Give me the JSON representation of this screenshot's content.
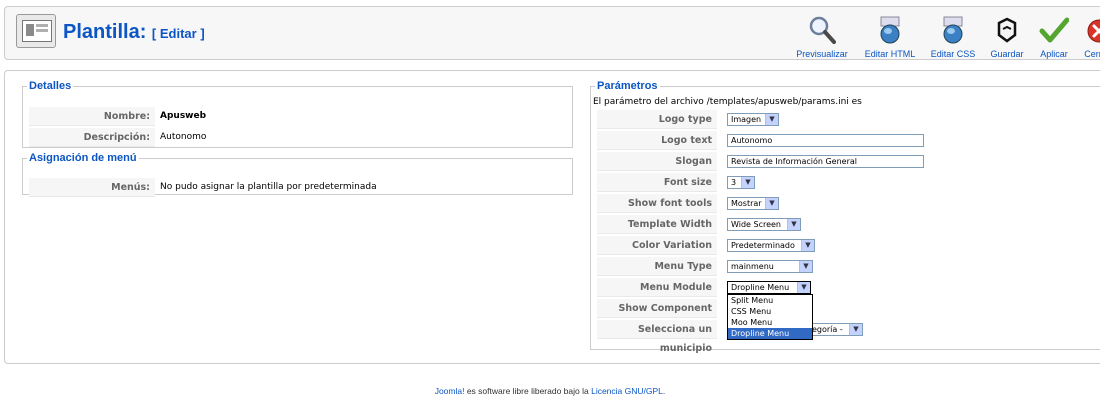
{
  "header": {
    "title": "Plantilla:",
    "subtitle": "[ Editar ]",
    "toolbar": [
      {
        "label": "Previsualizar",
        "icon": "magnifier-icon"
      },
      {
        "label": "Editar HTML",
        "icon": "edit-html-icon"
      },
      {
        "label": "Editar CSS",
        "icon": "edit-css-icon"
      },
      {
        "label": "Guardar",
        "icon": "save-icon"
      },
      {
        "label": "Aplicar",
        "icon": "apply-check-icon"
      },
      {
        "label": "Cerrar",
        "icon": "close-icon"
      }
    ]
  },
  "details": {
    "legend": "Detalles",
    "rows": [
      {
        "label": "Nombre:",
        "value": "Apusweb"
      },
      {
        "label": "Descripción:",
        "value": "Autonomo"
      }
    ]
  },
  "menu_assignment": {
    "legend": "Asignación de menú",
    "label": "Menús:",
    "value": "No pudo asignar la plantilla por predeterminada"
  },
  "params": {
    "legend": "Parámetros",
    "intro": "El parámetro del archivo /templates/apusweb/params.ini es",
    "rows": [
      {
        "label": "Logo type",
        "value": "Imagen"
      },
      {
        "label": "Logo text",
        "value": "Autonomo"
      },
      {
        "label": "Slogan",
        "value": "Revista de Información General"
      },
      {
        "label": "Font size",
        "value": "3"
      },
      {
        "label": "Show font tools",
        "value": "Mostrar"
      },
      {
        "label": "Template Width",
        "value": "Wide Screen"
      },
      {
        "label": "Color Variation",
        "value": "Predeterminado"
      },
      {
        "label": "Menu Type",
        "value": "mainmenu"
      },
      {
        "label": "Menu Module",
        "value": "Dropline Menu"
      },
      {
        "label": "Show Component",
        "value": ""
      },
      {
        "label": "Selecciona un municipio",
        "value": "egoría -"
      }
    ],
    "dropdown_options": [
      "Split Menu",
      "CSS Menu",
      "Moo Menu",
      "Dropline Menu"
    ]
  },
  "footer": {
    "prefix": "Joomla!",
    "middle": " es software libre liberado bajo la ",
    "link": "Licencia GNU/GPL",
    "suffix": "."
  },
  "colors": {
    "accent": "#0b55c4",
    "selected_option": "#316ac5"
  }
}
